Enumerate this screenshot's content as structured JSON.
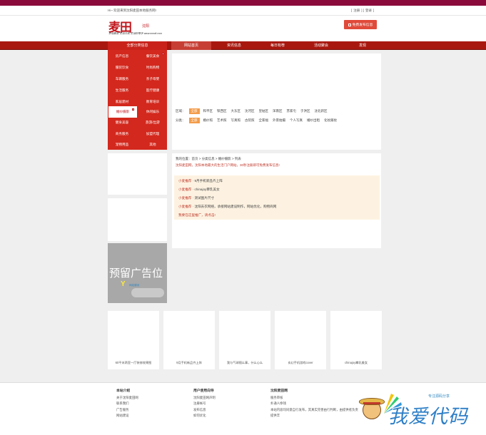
{
  "topbar": {
    "welcome": "Hi~ 欢迎来到沈阳麦田本地服务网!",
    "login": "注册",
    "register": "登录"
  },
  "header": {
    "logo_big": "麦田",
    "logo_small": "沈阳",
    "logo_tag": "本地服务 生活分类 生活好帮手 www.mmdt.com",
    "post_button": "免费发布信息"
  },
  "nav": {
    "category_title": "全部分类信息",
    "items": [
      "网站首页",
      "资讯信息",
      "每日有荐",
      "活动聚会",
      "发现"
    ]
  },
  "categories": [
    "房产信息",
    "餐饮美食",
    "服装饮食",
    "时尚购物",
    "车辆服务",
    "亲子母婴",
    "生活服务",
    "医疗健康",
    "家居建材",
    "教育培训",
    "婚纱摄影",
    "休闲娱乐",
    "健身美容",
    "旅游/出游",
    "商务服务",
    "加盟代理",
    "宠物用品",
    "其他"
  ],
  "filters": {
    "area_label": "区域：",
    "areas": [
      "全部",
      "和平区",
      "铁西区",
      "大东区",
      "沈河区",
      "皇姑区",
      "浑南区",
      "苏家屯",
      "于洪区",
      "沈北新区",
      "沈北新区"
    ],
    "type_label": "分类：",
    "types": [
      "全部",
      "婚纱照",
      "艺术照",
      "写真照",
      "古装照",
      "全家福",
      "外景拍摄",
      "个人写真",
      "婚纱出租",
      "化妆跟妆"
    ]
  },
  "crumb": "我的位置：首页 > 分类信息 > 婚纱摄影 > 列表",
  "notice": "沈阳麦田网，沈阳本地最大的生活门户网站，30秒注册即可免费发布信息!",
  "recommendations": [
    {
      "label": "小麦推荐",
      "text": "9月手机新品齐上阵"
    },
    {
      "label": "小麦推荐",
      "text": "chinajoy攀乳美女"
    },
    {
      "label": "小麦推荐",
      "text": "测试图片尺寸"
    },
    {
      "label": "小麦推荐",
      "text": "沈阳去衣网络，承接网站建设制作，网站优化，购物商网"
    }
  ],
  "rec_link": "我要在这里推广，请点击!",
  "ad": {
    "text": "预留广告位",
    "mark": "Y",
    "spark": "网站建设"
  },
  "thumbs": [
    "60平米两室一厅装修效果图",
    "9月手机新品齐上阵",
    "我与气球随么事，什么心么",
    "玄幻手机游戏cover",
    "chinajoy攀乳美女"
  ],
  "footer": {
    "cols": [
      {
        "title": "本站介绍",
        "items": [
          "关于沈阳麦田网",
          "联系我们",
          "广告服务",
          "网站建设"
        ]
      },
      {
        "title": "用户使用向导",
        "items": [
          "沈阳麦田网声明",
          "注册帐号",
          "发布信息",
          "如何优化"
        ]
      },
      {
        "title": "沈阳麦田网",
        "items": [
          "服务审核",
          "扑通人挣钱",
          "本站内容均同意自行发布，其真实完善由行判断，由提供者负责",
          "提供丰"
        ]
      }
    ]
  },
  "watermark": {
    "site": "专注源码分享",
    "cn": "我爱代码"
  },
  "colors": {
    "brand_red": "#c0161c",
    "nav_red": "#a8180f",
    "top_purple": "#8b0a3c",
    "accent_orange": "#f39c4a",
    "rec_bg": "#fdf2e1"
  }
}
